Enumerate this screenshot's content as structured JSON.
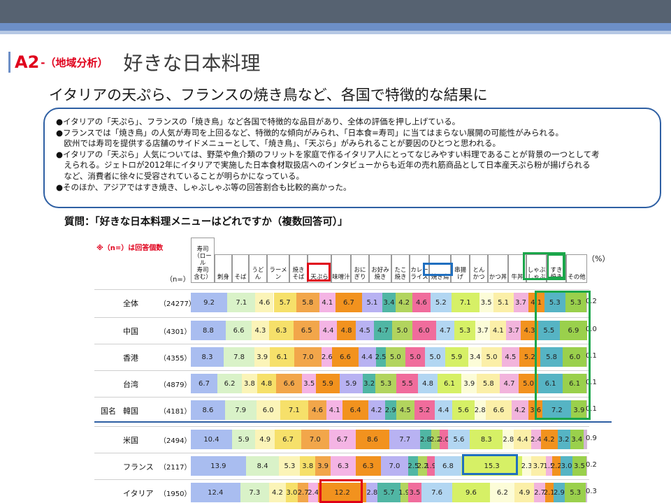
{
  "slide": {
    "code": "A2",
    "section_label": "-（地域分析）",
    "title": "好きな日本料理",
    "subtitle": "イタリアの天ぷら、フランスの焼き鳥など、各国で特徴的な結果に",
    "bullets": [
      "●イタリアの「天ぷら」、フランスの「焼き鳥」など各国で特徴的な品目があり、全体の評価を押し上げている。",
      "●フランスでは「焼き鳥」の人気が寿司を上回るなど、特徴的な傾向がみられ、「日本食=寿司」に当てはまらない展開の可能性がみられる。",
      "　欧州では寿司を提供する店舗のサイドメニューとして、「焼き鳥」、「天ぷら」がみられることが要因のひとつと思われる。",
      "●イタリアの「天ぷら」人気については、野菜や魚介類のフリットを家庭で作るイタリア人にとってなじみやすい料理であることが背景の一つとして考",
      "　えられる。ジェトロが2012年にイタリアで実施した日本食材取扱店へのインタビューからも近年の売れ筋商品として日本産天ぷら粉が揚げられる",
      "　など、消費者に徐々に受容されていることが明らかになっている。",
      "●そのほか、アジアではすき焼き、しゃぶしゃぶ等の回答割合も比較的高かった。"
    ],
    "question": "質問：「好きな日本料理メニューはどれですか（複数回答可）」",
    "note": "※（n=）は回答個数",
    "unit": "（%）",
    "n_header": "（n=）",
    "row_group_label": "国名"
  },
  "colors": {
    "accent_red": "#e0001c",
    "accent_blue": "#2e5fa3",
    "highlight_red": "#e00016",
    "highlight_blue": "#1f6fc0",
    "highlight_green": "#1aa64a"
  },
  "chart_data": {
    "type": "bar",
    "stacked": "100%",
    "orientation": "horizontal",
    "categories": [
      "寿司（ロール寿司含む）",
      "刺身",
      "そば",
      "うどん",
      "ラーメン",
      "焼きそば",
      "天ぷら",
      "味噌汁",
      "おにぎり",
      "お好み焼き",
      "たこ焼き",
      "カレーライス",
      "焼き鳥",
      "串揚げ",
      "とんかつ",
      "かつ丼",
      "牛丼",
      "しゃぶしゃぶ",
      "すき焼き",
      "その他"
    ],
    "category_headers": [
      "寿司\n（ロール\n寿司\n含む）",
      "刺身",
      "そば",
      "うどん",
      "ラーメン",
      "焼き\nそば",
      "天ぷら",
      "味噌汁",
      "おに\nぎり",
      "お好み\n焼き",
      "たこ\n焼き",
      "カレー\nライス",
      "焼き鳥",
      "串揚げ",
      "とん\nかつ",
      "かつ丼",
      "牛丼",
      "しゃぶ\nしゃぶ",
      "すき\n焼き",
      "その他"
    ],
    "series_colors": [
      "#a9bdf0",
      "#d9f2c8",
      "#fbf4b8",
      "#f6e06a",
      "#f2a64a",
      "#f4b4e4",
      "#f2921e",
      "#b8b2f2",
      "#50b6a4",
      "#b2d45e",
      "#f06c9c",
      "#b2d6f2",
      "#d6f066",
      "#fcfcd8",
      "#fbefa8",
      "#f2b4dc",
      "#f2921e",
      "#56b4c4",
      "#9ad04c",
      "#d2b8d4"
    ],
    "rows": [
      {
        "label": "全体",
        "n": "（24277）",
        "values": [
          9.2,
          7.1,
          4.6,
          5.7,
          5.8,
          4.1,
          6.7,
          5.1,
          3.4,
          4.2,
          4.6,
          5.2,
          7.1,
          3.5,
          5.1,
          3.7,
          4.1,
          5.3,
          5.3,
          0.2
        ]
      },
      {
        "label": "中国",
        "n": "（4301）",
        "values": [
          8.8,
          6.6,
          4.3,
          6.3,
          6.5,
          4.4,
          4.8,
          4.5,
          4.7,
          5.0,
          6.0,
          4.7,
          5.3,
          3.7,
          4.1,
          3.7,
          4.3,
          5.5,
          6.9,
          0.0
        ]
      },
      {
        "label": "香港",
        "n": "（4355）",
        "values": [
          8.3,
          7.8,
          3.9,
          6.1,
          7.0,
          2.6,
          6.6,
          4.4,
          2.5,
          5.0,
          5.0,
          5.0,
          5.9,
          3.4,
          5.0,
          4.5,
          5.2,
          5.8,
          6.0,
          0.1
        ]
      },
      {
        "label": "台湾",
        "n": "（4879）",
        "values": [
          6.7,
          6.2,
          3.8,
          4.8,
          6.6,
          3.5,
          5.9,
          5.9,
          3.2,
          5.3,
          5.5,
          4.8,
          6.1,
          3.9,
          5.8,
          4.7,
          5.0,
          6.1,
          6.1,
          0.1
        ]
      },
      {
        "label": "韓国",
        "n": "（4181）",
        "values": [
          8.6,
          7.9,
          6.0,
          7.1,
          4.6,
          4.1,
          6.4,
          4.2,
          2.9,
          4.5,
          5.2,
          4.4,
          5.6,
          2.8,
          6.6,
          4.2,
          3.6,
          7.2,
          3.9,
          0.1
        ]
      },
      {
        "label": "米国",
        "n": "（2494）",
        "values": [
          10.4,
          5.9,
          4.9,
          6.7,
          7.0,
          6.7,
          8.6,
          7.7,
          2.8,
          2.2,
          2.0,
          5.6,
          8.3,
          2.8,
          4.4,
          2.4,
          4.2,
          3.2,
          3.4,
          0.9
        ]
      },
      {
        "label": "フランス",
        "n": "（2117）",
        "values": [
          13.9,
          8.4,
          5.3,
          3.8,
          3.9,
          6.3,
          6.3,
          7.0,
          2.5,
          2.2,
          1.9,
          6.8,
          15.3,
          2.3,
          3.7,
          1.5,
          2.2,
          3.0,
          3.5,
          0.2
        ]
      },
      {
        "label": "イタリア",
        "n": "（1950）",
        "values": [
          12.4,
          7.3,
          4.2,
          3.0,
          2.7,
          2.4,
          12.2,
          2.8,
          5.7,
          1.9,
          3.5,
          7.6,
          9.6,
          6.2,
          4.9,
          2.7,
          2.1,
          2.9,
          5.3,
          0.3
        ]
      }
    ]
  }
}
